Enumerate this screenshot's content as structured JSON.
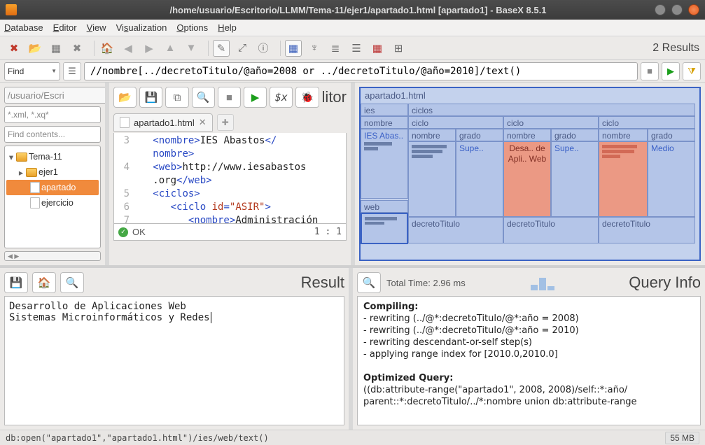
{
  "window": {
    "title": "/home/usuario/Escritorio/LLMM/Tema-11/ejer1/apartado1.html [apartado1] - BaseX 8.5.1"
  },
  "menu": {
    "database": "Database",
    "editor": "Editor",
    "view": "View",
    "visualization": "Visualization",
    "options": "Options",
    "help": "Help"
  },
  "toolbar": {
    "results": "2 Results"
  },
  "queryrow": {
    "find": "Find",
    "xquery": "//nombre[../decretoTitulo/@año=2008 or ../decretoTitulo/@año=2010]/text()"
  },
  "nav": {
    "path": "/usuario/Escri",
    "filter": "*.xml, *.xq*",
    "find": "Find contents...",
    "tree": {
      "folder1": "Tema-11",
      "folder2": "ejer1",
      "file_sel": "apartado",
      "file2": "ejercicio"
    }
  },
  "editor": {
    "title": "litor",
    "tab": "apartado1.html",
    "ok": "OK",
    "linecol": "1 : 1",
    "code": {
      "l3a": "<nombre>",
      "l3b": "IES Abastos",
      "l3c": "</",
      "l4a": "nombre>",
      "l4b": "<web>",
      "l4c": "http://www.iesabastos",
      "l5a": ".org",
      "l5b": "</web>",
      "l5c": "<ciclos>",
      "l6a": "<ciclo ",
      "l6b": "id",
      "l6c": "=",
      "l6d": "\"ASIR\"",
      "l6e": ">",
      "l7a": "<nombre>",
      "l7b": "Administración"
    }
  },
  "viz": {
    "file": "apartado1.html",
    "ies": "ies",
    "nombre": "nombre",
    "ciclos": "ciclos",
    "iesabas": "IES Abas..",
    "web": "web",
    "ciclo": "ciclo",
    "grado": "grado",
    "supe": "Supe..",
    "medio": "Medio",
    "desa": "Desa.. de Apli.. Web",
    "decreto": "decretoTitulo"
  },
  "result": {
    "title": "Result",
    "text": "Desarrollo de Aplicaciones Web\nSistemas Microinformáticos y Redes"
  },
  "info": {
    "title": "Query Info",
    "totaltime": "Total Time: 2.96 ms",
    "compiling": "Compiling:",
    "c1": "- rewriting (../@*:decretoTitulo/@*:año = 2008)",
    "c2": "- rewriting (../@*:decretoTitulo/@*:año = 2010)",
    "c3": "- rewriting descendant-or-self step(s)",
    "c4": "- applying range index for [2010.0,2010.0]",
    "optq": "Optimized Query:",
    "oq1": "((db:attribute-range(\"apartado1\", 2008, 2008)/self::*:año/",
    "oq2": "parent::*:decretoTitulo/../*:nombre union db:attribute-range"
  },
  "status": {
    "path": "db:open(\"apartado1\",\"apartado1.html\")/ies/web/text()",
    "mem": "55 MB"
  }
}
